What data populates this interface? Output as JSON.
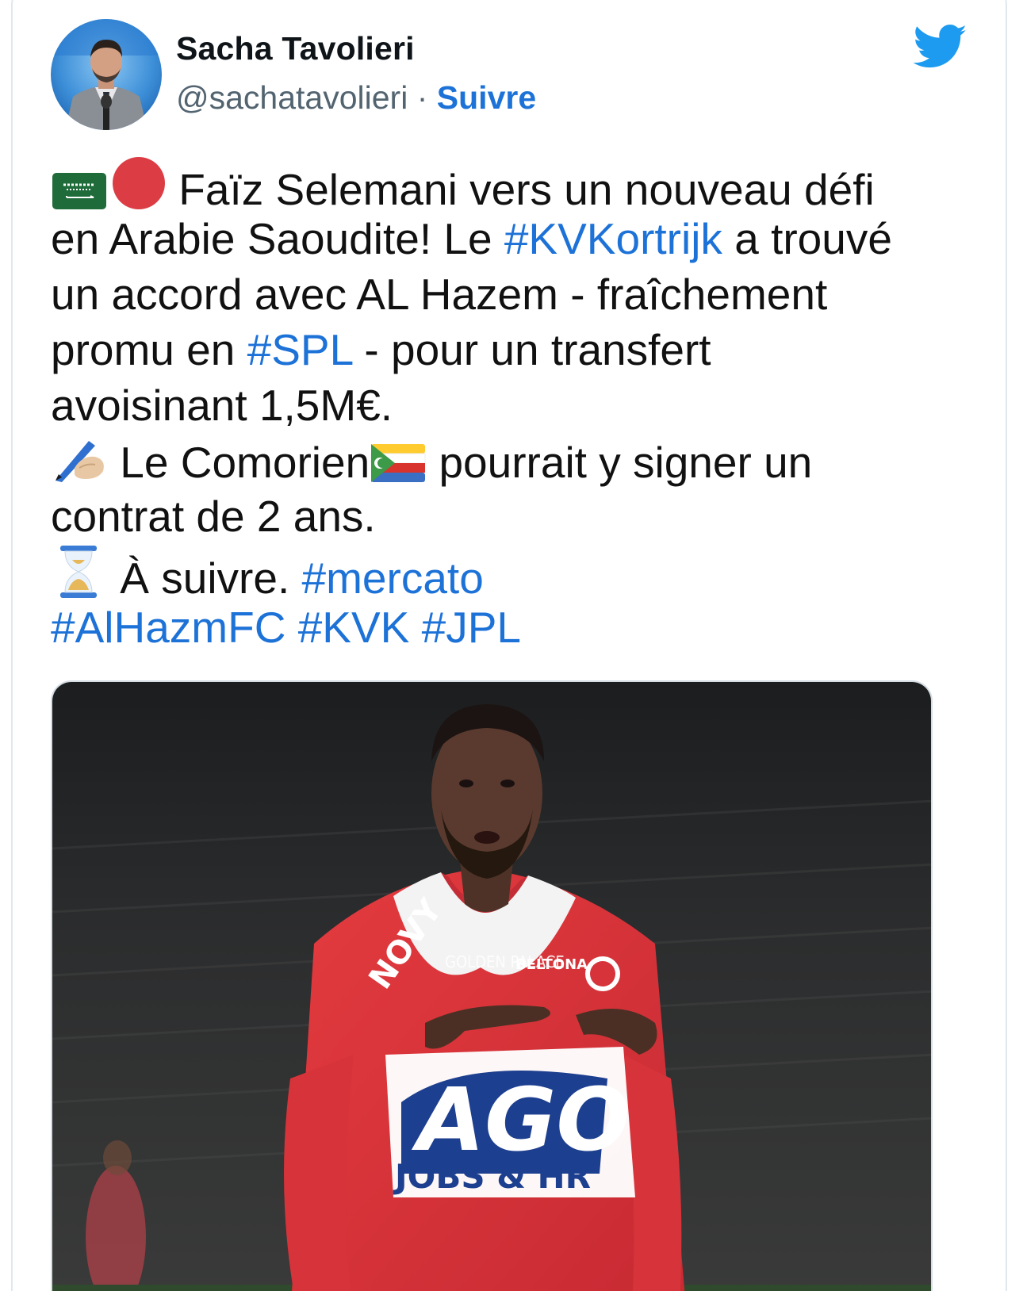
{
  "tweet": {
    "author": {
      "name": "Sacha Tavolieri",
      "handle": "@sachatavolieri",
      "separator": "·",
      "follow_label": "Suivre"
    },
    "icons": {
      "brand": "twitter-bird-icon",
      "brand_color": "#1d9bf0",
      "flag_1": "saudi-arabia-flag-icon",
      "marker": "red-circle-icon",
      "writing": "writing-hand-icon",
      "flag_2": "comoros-flag-icon",
      "hourglass": "hourglass-icon"
    },
    "text": {
      "line1": "Faïz Selemani vers un nouveau défi",
      "line2_a": "en Arabie Saoudite! Le ",
      "hashtag_kvkortrijk": "#KVKortrijk",
      "line2_b": " a trouvé",
      "line3": "un accord avec AL Hazem - fraîchement",
      "line4_a": "promu en ",
      "hashtag_spl": "#SPL",
      "line4_b": " - pour un transfert",
      "line5": "avoisinant 1,5M€.",
      "line6_a": "Le Comorien",
      "line6_b": "pourrait y signer un",
      "line7": "contrat de 2 ans.",
      "line8_a": "À suivre. ",
      "hashtag_mercato": "#mercato",
      "hashtag_alhazmfc": "#AlHazmFC",
      "hashtag_kvk": "#KVK",
      "hashtag_jpl": "#JPL"
    },
    "media": {
      "jersey_sponsor_1": "NOVY",
      "jersey_sponsor_2": "GOLDEN PALACE",
      "jersey_sponsor_3": "BELTONA",
      "jersey_sponsor_4": "AGO",
      "jersey_sponsor_5": "JOBS & HR"
    },
    "colors": {
      "link": "#1d72d8",
      "text": "#111111",
      "muted": "#536471",
      "border": "#e1e8ed"
    }
  }
}
